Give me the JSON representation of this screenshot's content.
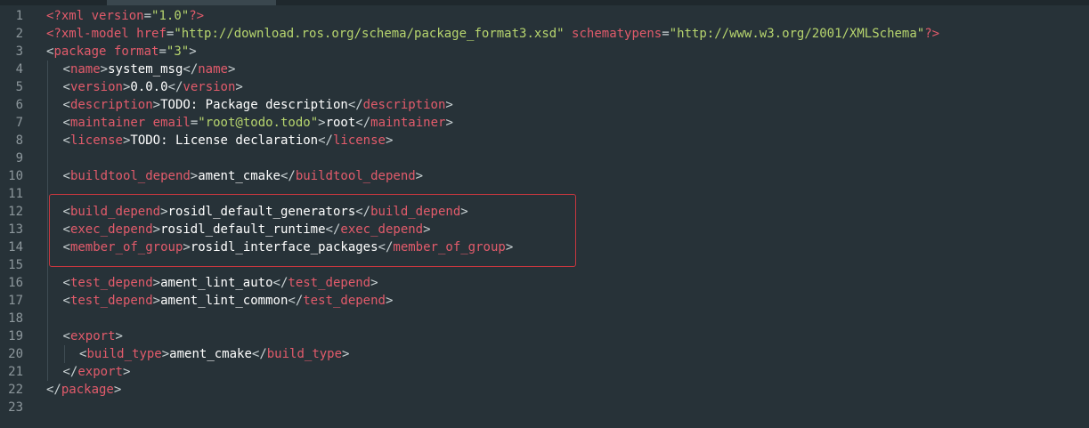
{
  "editor": {
    "language": "xml",
    "highlight_color": "#c8373f",
    "line_numbers": [
      "1",
      "2",
      "3",
      "4",
      "5",
      "6",
      "7",
      "8",
      "9",
      "10",
      "11",
      "12",
      "13",
      "14",
      "15",
      "16",
      "17",
      "18",
      "19",
      "20",
      "21",
      "22",
      "23"
    ],
    "lines": [
      {
        "indent": 0,
        "tokens": [
          {
            "t": "pi",
            "v": "<?xml"
          },
          {
            "t": "text",
            "v": " "
          },
          {
            "t": "attr",
            "v": "version"
          },
          {
            "t": "eq",
            "v": "="
          },
          {
            "t": "str",
            "v": "\"1.0\""
          },
          {
            "t": "pi",
            "v": "?>"
          }
        ]
      },
      {
        "indent": 0,
        "tokens": [
          {
            "t": "pi",
            "v": "<?xml-model"
          },
          {
            "t": "text",
            "v": " "
          },
          {
            "t": "attr",
            "v": "href"
          },
          {
            "t": "eq",
            "v": "="
          },
          {
            "t": "str",
            "v": "\"http://download.ros.org/schema/package_format3.xsd\""
          },
          {
            "t": "text",
            "v": " "
          },
          {
            "t": "attr",
            "v": "schematypens"
          },
          {
            "t": "eq",
            "v": "="
          },
          {
            "t": "str",
            "v": "\"http://www.w3.org/2001/XMLSchema\""
          },
          {
            "t": "pi",
            "v": "?>"
          }
        ]
      },
      {
        "indent": 0,
        "tokens": [
          {
            "t": "punct",
            "v": "<"
          },
          {
            "t": "tag",
            "v": "package"
          },
          {
            "t": "text",
            "v": " "
          },
          {
            "t": "attr",
            "v": "format"
          },
          {
            "t": "eq",
            "v": "="
          },
          {
            "t": "str",
            "v": "\"3\""
          },
          {
            "t": "punct",
            "v": ">"
          }
        ]
      },
      {
        "indent": 1,
        "tokens": [
          {
            "t": "punct",
            "v": "<"
          },
          {
            "t": "tag",
            "v": "name"
          },
          {
            "t": "punct",
            "v": ">"
          },
          {
            "t": "text",
            "v": "system_msg"
          },
          {
            "t": "punct",
            "v": "</"
          },
          {
            "t": "tag",
            "v": "name"
          },
          {
            "t": "punct",
            "v": ">"
          }
        ]
      },
      {
        "indent": 1,
        "tokens": [
          {
            "t": "punct",
            "v": "<"
          },
          {
            "t": "tag",
            "v": "version"
          },
          {
            "t": "punct",
            "v": ">"
          },
          {
            "t": "text",
            "v": "0.0.0"
          },
          {
            "t": "punct",
            "v": "</"
          },
          {
            "t": "tag",
            "v": "version"
          },
          {
            "t": "punct",
            "v": ">"
          }
        ]
      },
      {
        "indent": 1,
        "tokens": [
          {
            "t": "punct",
            "v": "<"
          },
          {
            "t": "tag",
            "v": "description"
          },
          {
            "t": "punct",
            "v": ">"
          },
          {
            "t": "text",
            "v": "TODO: Package description"
          },
          {
            "t": "punct",
            "v": "</"
          },
          {
            "t": "tag",
            "v": "description"
          },
          {
            "t": "punct",
            "v": ">"
          }
        ]
      },
      {
        "indent": 1,
        "tokens": [
          {
            "t": "punct",
            "v": "<"
          },
          {
            "t": "tag",
            "v": "maintainer"
          },
          {
            "t": "text",
            "v": " "
          },
          {
            "t": "attr",
            "v": "email"
          },
          {
            "t": "eq",
            "v": "="
          },
          {
            "t": "str",
            "v": "\"root@todo.todo\""
          },
          {
            "t": "punct",
            "v": ">"
          },
          {
            "t": "text",
            "v": "root"
          },
          {
            "t": "punct",
            "v": "</"
          },
          {
            "t": "tag",
            "v": "maintainer"
          },
          {
            "t": "punct",
            "v": ">"
          }
        ]
      },
      {
        "indent": 1,
        "tokens": [
          {
            "t": "punct",
            "v": "<"
          },
          {
            "t": "tag",
            "v": "license"
          },
          {
            "t": "punct",
            "v": ">"
          },
          {
            "t": "text",
            "v": "TODO: License declaration"
          },
          {
            "t": "punct",
            "v": "</"
          },
          {
            "t": "tag",
            "v": "license"
          },
          {
            "t": "punct",
            "v": ">"
          }
        ]
      },
      {
        "indent": 1,
        "tokens": []
      },
      {
        "indent": 1,
        "tokens": [
          {
            "t": "punct",
            "v": "<"
          },
          {
            "t": "tag",
            "v": "buildtool_depend"
          },
          {
            "t": "punct",
            "v": ">"
          },
          {
            "t": "text",
            "v": "ament_cmake"
          },
          {
            "t": "punct",
            "v": "</"
          },
          {
            "t": "tag",
            "v": "buildtool_depend"
          },
          {
            "t": "punct",
            "v": ">"
          }
        ]
      },
      {
        "indent": 1,
        "tokens": []
      },
      {
        "indent": 1,
        "tokens": [
          {
            "t": "punct",
            "v": "<"
          },
          {
            "t": "tag",
            "v": "build_depend"
          },
          {
            "t": "punct",
            "v": ">"
          },
          {
            "t": "text",
            "v": "rosidl_default_generators"
          },
          {
            "t": "punct",
            "v": "</"
          },
          {
            "t": "tag",
            "v": "build_depend"
          },
          {
            "t": "punct",
            "v": ">"
          }
        ]
      },
      {
        "indent": 1,
        "tokens": [
          {
            "t": "punct",
            "v": "<"
          },
          {
            "t": "tag",
            "v": "exec_depend"
          },
          {
            "t": "punct",
            "v": ">"
          },
          {
            "t": "text",
            "v": "rosidl_default_runtime"
          },
          {
            "t": "punct",
            "v": "</"
          },
          {
            "t": "tag",
            "v": "exec_depend"
          },
          {
            "t": "punct",
            "v": ">"
          }
        ]
      },
      {
        "indent": 1,
        "tokens": [
          {
            "t": "punct",
            "v": "<"
          },
          {
            "t": "tag",
            "v": "member_of_group"
          },
          {
            "t": "punct",
            "v": ">"
          },
          {
            "t": "text",
            "v": "rosidl_interface_packages"
          },
          {
            "t": "punct",
            "v": "</"
          },
          {
            "t": "tag",
            "v": "member_of_group"
          },
          {
            "t": "punct",
            "v": ">"
          }
        ]
      },
      {
        "indent": 1,
        "tokens": []
      },
      {
        "indent": 1,
        "tokens": [
          {
            "t": "punct",
            "v": "<"
          },
          {
            "t": "tag",
            "v": "test_depend"
          },
          {
            "t": "punct",
            "v": ">"
          },
          {
            "t": "text",
            "v": "ament_lint_auto"
          },
          {
            "t": "punct",
            "v": "</"
          },
          {
            "t": "tag",
            "v": "test_depend"
          },
          {
            "t": "punct",
            "v": ">"
          }
        ]
      },
      {
        "indent": 1,
        "tokens": [
          {
            "t": "punct",
            "v": "<"
          },
          {
            "t": "tag",
            "v": "test_depend"
          },
          {
            "t": "punct",
            "v": ">"
          },
          {
            "t": "text",
            "v": "ament_lint_common"
          },
          {
            "t": "punct",
            "v": "</"
          },
          {
            "t": "tag",
            "v": "test_depend"
          },
          {
            "t": "punct",
            "v": ">"
          }
        ]
      },
      {
        "indent": 1,
        "tokens": []
      },
      {
        "indent": 1,
        "tokens": [
          {
            "t": "punct",
            "v": "<"
          },
          {
            "t": "tag",
            "v": "export"
          },
          {
            "t": "punct",
            "v": ">"
          }
        ]
      },
      {
        "indent": 2,
        "tokens": [
          {
            "t": "punct",
            "v": "<"
          },
          {
            "t": "tag",
            "v": "build_type"
          },
          {
            "t": "punct",
            "v": ">"
          },
          {
            "t": "text",
            "v": "ament_cmake"
          },
          {
            "t": "punct",
            "v": "</"
          },
          {
            "t": "tag",
            "v": "build_type"
          },
          {
            "t": "punct",
            "v": ">"
          }
        ]
      },
      {
        "indent": 1,
        "tokens": [
          {
            "t": "punct",
            "v": "</"
          },
          {
            "t": "tag",
            "v": "export"
          },
          {
            "t": "punct",
            "v": ">"
          }
        ]
      },
      {
        "indent": 0,
        "tokens": [
          {
            "t": "punct",
            "v": "</"
          },
          {
            "t": "tag",
            "v": "package"
          },
          {
            "t": "punct",
            "v": ">"
          }
        ]
      },
      {
        "indent": 0,
        "tokens": []
      }
    ]
  }
}
